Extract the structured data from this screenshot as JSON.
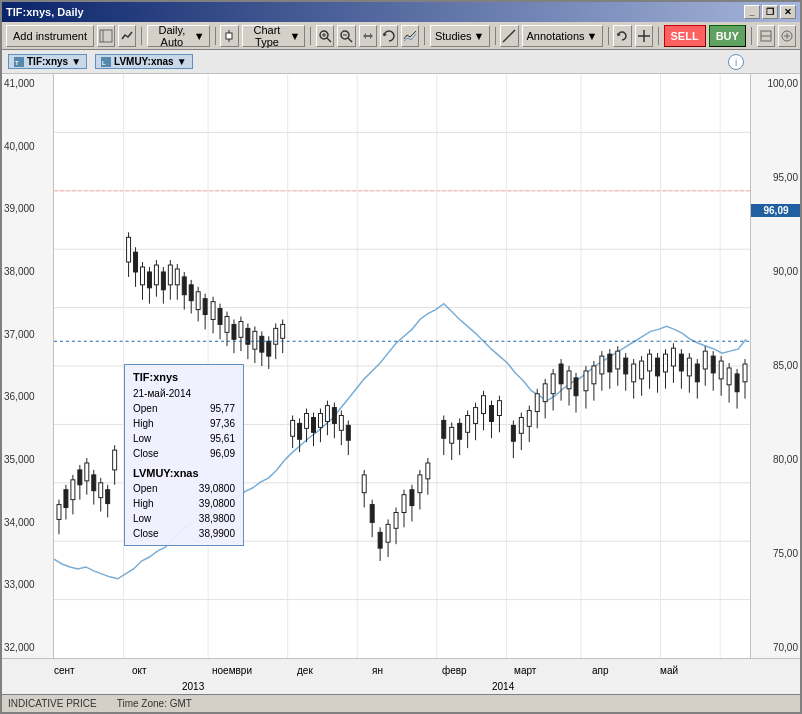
{
  "window": {
    "title": "TIF:xnys, Daily"
  },
  "toolbar": {
    "add_instrument": "Add instrument",
    "timeframe": "Daily, Auto",
    "chart_type": "Chart Type",
    "studies": "Studies",
    "annotations": "Annotations",
    "sell": "SELL",
    "buy": "BUY"
  },
  "chart_header": {
    "instrument1": "TIF:xnys",
    "instrument2": "LVMUY:xnas"
  },
  "tooltip": {
    "title": "TIF:xnys",
    "date": "21-май-2014",
    "open_label": "Open",
    "open_value": "95,77",
    "high_label": "High",
    "high_value": "97,36",
    "low_label": "Low",
    "low_value": "95,61",
    "close_label": "Close",
    "close_value": "96,09",
    "title2": "LVMUY:xnas",
    "open2_label": "Open",
    "open2_value": "39,0800",
    "high2_label": "High",
    "high2_value": "39,0800",
    "low2_label": "Low",
    "low2_value": "38,9800",
    "close2_label": "Close",
    "close2_value": "38,9900"
  },
  "y_axis": {
    "labels_right": [
      "100,00",
      "95,00",
      "90,00",
      "85,00",
      "80,00",
      "75,00",
      "70,00"
    ],
    "price_label": "96,09",
    "labels_left": [
      "41,000",
      "40,000",
      "39,000",
      "38,000",
      "37,000",
      "36,000",
      "35,000",
      "34,000",
      "33,000",
      "32,000"
    ]
  },
  "x_axis": {
    "labels": [
      "сент",
      "окт",
      "ноември",
      "дек",
      "ян",
      "февр",
      "март",
      "апр",
      "май"
    ],
    "year_labels": [
      "2013",
      "",
      "",
      "",
      "2014",
      "",
      "",
      "",
      ""
    ]
  },
  "bottom_bar": {
    "indicative": "INDICATIVE PRICE",
    "timezone": "Time Zone: GMT"
  }
}
